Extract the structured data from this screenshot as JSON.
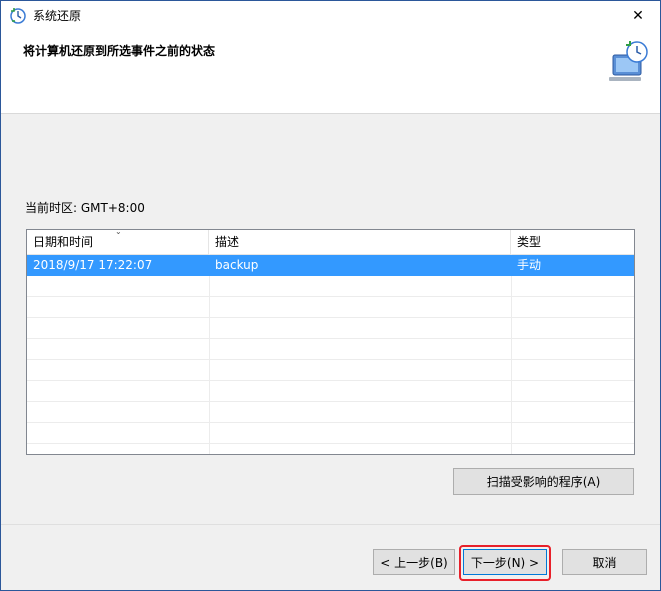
{
  "window": {
    "title": "系统还原",
    "close_glyph": "✕"
  },
  "header": {
    "title": "将计算机还原到所选事件之前的状态"
  },
  "timezone": {
    "label": "当前时区: GMT+8:00"
  },
  "table": {
    "columns": [
      "日期和时间",
      "描述",
      "类型"
    ],
    "sort_glyph": "⌄",
    "rows": [
      {
        "datetime": "2018/9/17 17:22:07",
        "description": "backup",
        "type": "手动",
        "selected": true
      }
    ]
  },
  "buttons": {
    "scan": "扫描受影响的程序(A)",
    "back": "< 上一步(B)",
    "next": "下一步(N) >",
    "cancel": "取消"
  },
  "colors": {
    "selection": "#3399ff",
    "accent": "#0078d7",
    "highlight_ring": "#e8202a"
  }
}
